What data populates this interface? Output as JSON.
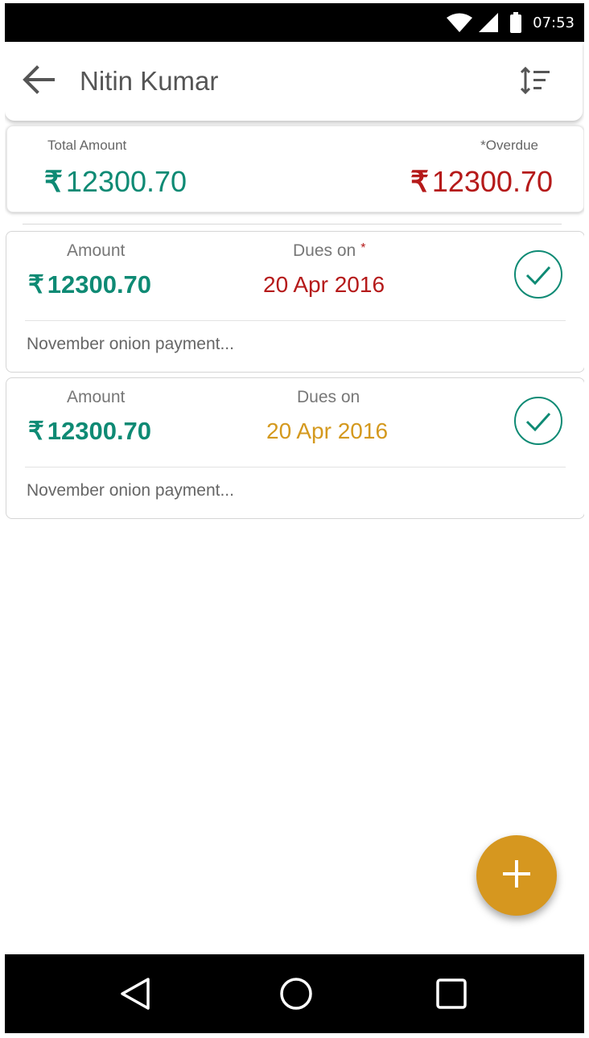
{
  "status_bar": {
    "time": "07:53"
  },
  "app_bar": {
    "title": "Nitin Kumar",
    "back_icon": "arrow-left-icon",
    "sort_icon": "sort-icon"
  },
  "summary": {
    "total_label": "Total Amount",
    "total_currency": "₹",
    "total_value": "12300.70",
    "overdue_label": "*Overdue",
    "overdue_currency": "₹",
    "overdue_value": "12300.70"
  },
  "dues": [
    {
      "amount_label": "Amount",
      "currency": "₹",
      "amount": "12300.70",
      "dues_label": "Dues on",
      "overdue_marker": "*",
      "date": "20 Apr 2016",
      "note": "November onion payment..."
    },
    {
      "amount_label": "Amount",
      "currency": "₹",
      "amount": "12300.70",
      "dues_label": "Dues on",
      "date": "20 Apr 2016",
      "note": "November onion payment..."
    }
  ],
  "fab": {
    "icon": "plus-icon"
  },
  "colors": {
    "teal": "#0e8a74",
    "overdue_red": "#b51a1a",
    "upcoming_amber": "#d4991e",
    "fab": "#d6971f"
  }
}
